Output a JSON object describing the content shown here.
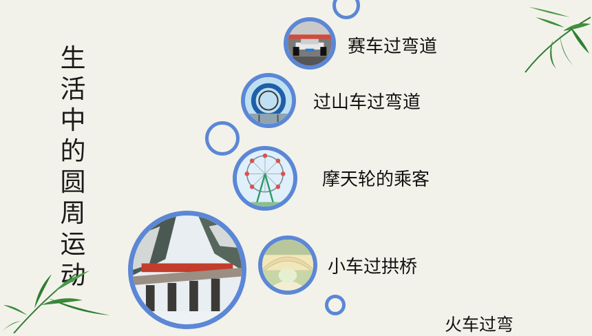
{
  "title_chars": [
    "生",
    "活",
    "中",
    "的",
    "圆",
    "周",
    "运",
    "动"
  ],
  "items": [
    {
      "label": "赛车过弯道"
    },
    {
      "label": "过山车过弯道"
    },
    {
      "label": "摩天轮的乘客"
    },
    {
      "label": "小车过拱桥"
    },
    {
      "label": "火车过弯"
    }
  ],
  "colors": {
    "ring": "#5b87d6",
    "background": "#f3f2ea",
    "bamboo": "#2e7d32"
  }
}
